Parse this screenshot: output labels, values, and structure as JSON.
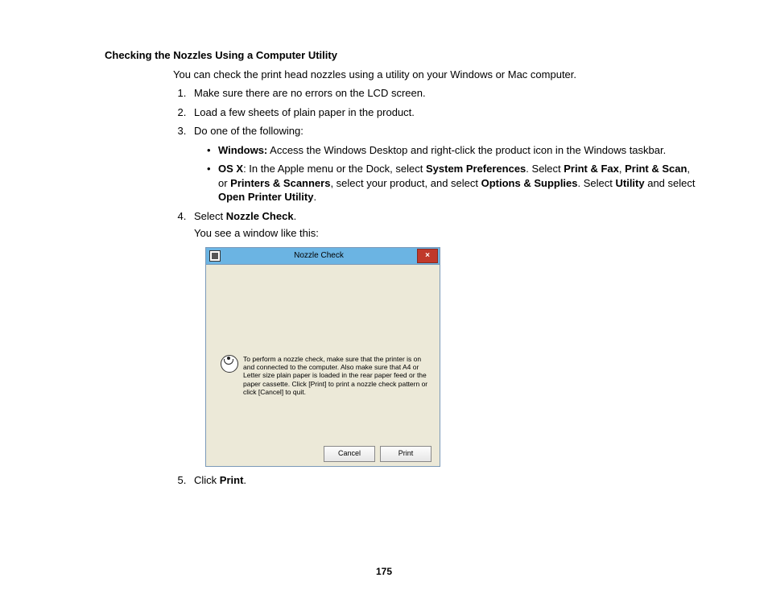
{
  "heading": "Checking the Nozzles Using a Computer Utility",
  "intro": "You can check the print head nozzles using a utility on your Windows or Mac computer.",
  "step1": "Make sure there are no errors on the LCD screen.",
  "step2": "Load a few sheets of plain paper in the product.",
  "step3_lead": "Do one of the following:",
  "bullet_win_bold": "Windows:",
  "bullet_win_rest": " Access the Windows Desktop and right-click the product icon in the Windows taskbar.",
  "bullet_osx_bold": "OS X",
  "bullet_osx_p1": ": In the Apple menu or the Dock, select ",
  "bullet_osx_b1": "System Preferences",
  "bullet_osx_p2": ". Select ",
  "bullet_osx_b2": "Print & Fax",
  "bullet_osx_p3": ", ",
  "bullet_osx_b3": "Print & Scan",
  "bullet_osx_p4": ", or ",
  "bullet_osx_b4": "Printers & Scanners",
  "bullet_osx_p5": ", select your product, and select ",
  "bullet_osx_b5": "Options & Supplies",
  "bullet_osx_p6": ". Select ",
  "bullet_osx_b6": "Utility",
  "bullet_osx_p7": " and select ",
  "bullet_osx_b7": "Open Printer Utility",
  "bullet_osx_p8": ".",
  "step4_p1": "Select ",
  "step4_b1": "Nozzle Check",
  "step4_p2": ".",
  "step4_follow": "You see a window like this:",
  "dialog": {
    "title": "Nozzle Check",
    "close_glyph": "×",
    "message": "To perform a nozzle check, make sure that the printer is on and connected to the computer. Also make sure that A4 or Letter size plain paper is loaded in the rear paper feed or the paper cassette. Click [Print] to print a nozzle check pattern or click [Cancel] to quit.",
    "cancel": "Cancel",
    "print": "Print"
  },
  "step5_p1": "Click ",
  "step5_b1": "Print",
  "step5_p2": ".",
  "page_number": "175"
}
